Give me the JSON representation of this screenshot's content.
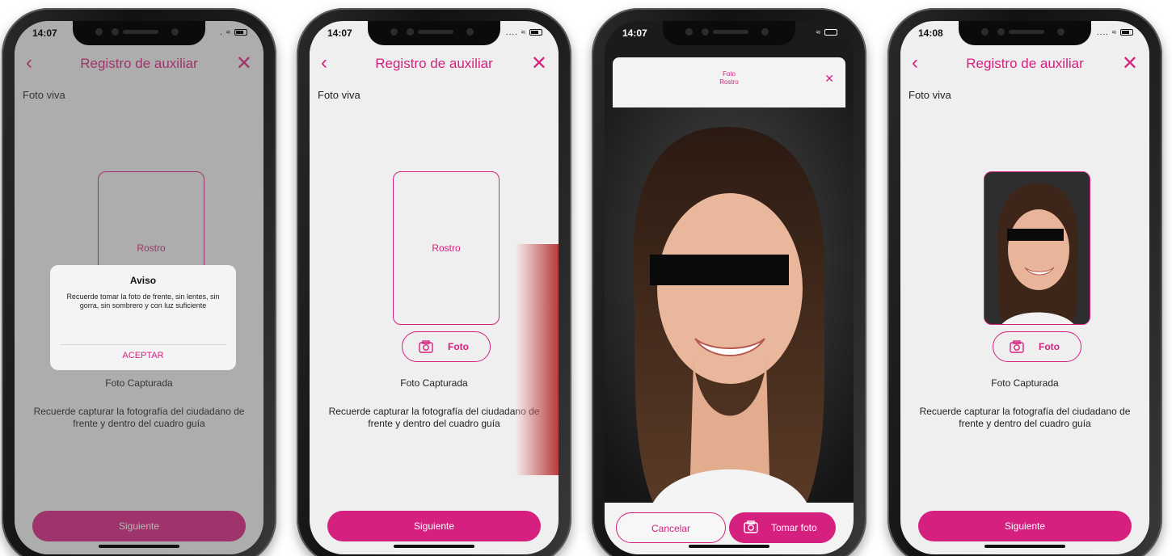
{
  "status": {
    "time_1": "14:07",
    "time_2": "14:07",
    "time_3": "14:07",
    "time_4": "14:08"
  },
  "nav": {
    "title": "Registro de auxiliar"
  },
  "form": {
    "section_label": "Foto viva",
    "frame_label": "Rostro",
    "photo_button": "Foto",
    "captured_label": "Foto Capturada",
    "hint": "Recuerde capturar la fotografía del ciudadano de frente y dentro del cuadro guía",
    "next_button": "Siguiente"
  },
  "dialog": {
    "title": "Aviso",
    "message": "Recuerde tomar la foto de frente, sin lentes, sin gorra, sin sombrero y con luz suficiente",
    "accept": "ACEPTAR"
  },
  "camera": {
    "sheet_title_1": "Foto",
    "sheet_title_2": "Rostro",
    "cancel": "Cancelar",
    "take_photo": "Tomar foto"
  },
  "colors": {
    "accent": "#d6207f",
    "screen_bg": "#efefef"
  }
}
